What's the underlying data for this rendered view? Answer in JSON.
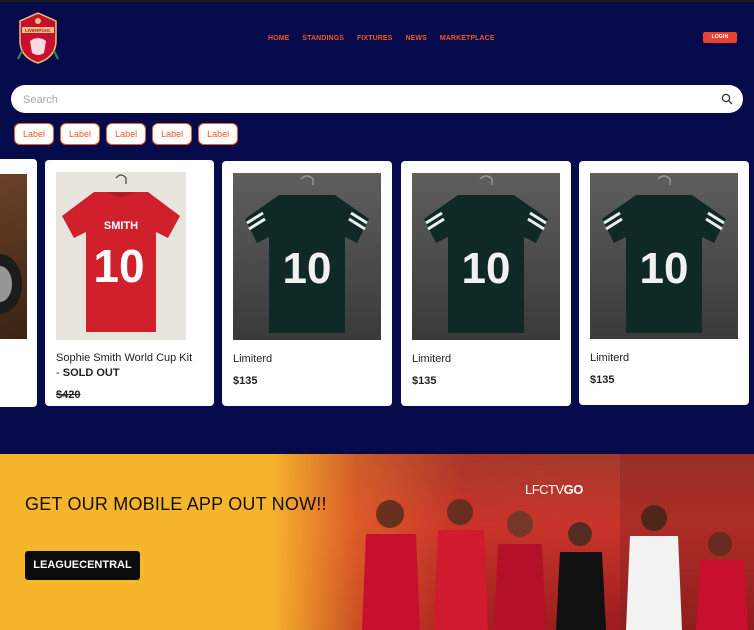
{
  "nav": {
    "items": [
      "HOME",
      "STANDINGS",
      "FIXTURES",
      "NEWS",
      "MARKETPLACE"
    ],
    "login": "LOGIN"
  },
  "brand": {
    "logo_text": "LIVERPOOL"
  },
  "search": {
    "placeholder": "Search"
  },
  "chips": [
    "Label",
    "Label",
    "Label",
    "Label",
    "Label"
  ],
  "products": [
    {
      "title_plain": "Sophie Smith World Cup Kit - ",
      "title_bold": "SOLD OUT",
      "price": "$420",
      "shirt_name": "SMITH",
      "shirt_number": "10"
    },
    {
      "title": "Limiterd",
      "price": "$135",
      "shirt_number": "10"
    },
    {
      "title": "Limiterd",
      "price": "$135",
      "shirt_number": "10"
    },
    {
      "title": "Limiterd",
      "price": "$135",
      "shirt_number": "10"
    }
  ],
  "banner": {
    "headline": "GET OUR MOBILE APP OUT NOW!!",
    "cta": "LEAGUECENTRAL",
    "lfctv_a": "LFCTV",
    "lfctv_b": "GO"
  },
  "colors": {
    "background": "#050a4a",
    "accent": "#f05a28",
    "banner": "#f7b52c"
  }
}
